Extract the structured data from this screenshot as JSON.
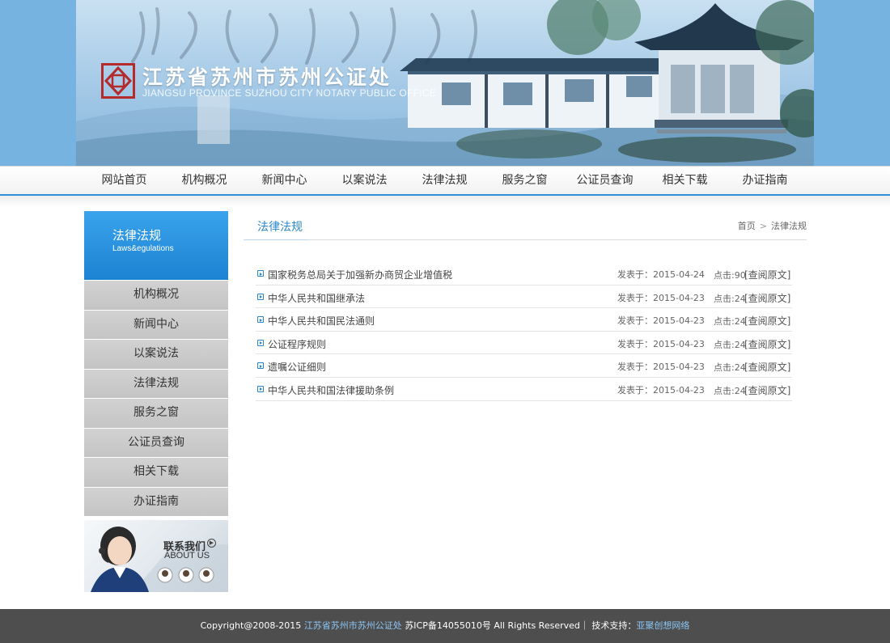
{
  "header": {
    "site_title": "江苏省苏州市苏州公证处",
    "site_subtitle": "JIANGSU PROVINCE SUZHOU CITY NOTARY PUBLIC OFFICE"
  },
  "nav": {
    "items": [
      {
        "label": "网站首页"
      },
      {
        "label": "机构概况"
      },
      {
        "label": "新闻中心"
      },
      {
        "label": "以案说法"
      },
      {
        "label": "法律法规"
      },
      {
        "label": "服务之窗"
      },
      {
        "label": "公证员查询"
      },
      {
        "label": "相关下载"
      },
      {
        "label": "办证指南"
      }
    ]
  },
  "sidebar": {
    "title_cn": "法律法规",
    "title_en": "Laws&egulations",
    "items": [
      {
        "label": "机构概况"
      },
      {
        "label": "新闻中心"
      },
      {
        "label": "以案说法"
      },
      {
        "label": "法律法规"
      },
      {
        "label": "服务之窗"
      },
      {
        "label": "公证员查询"
      },
      {
        "label": "相关下载"
      },
      {
        "label": "办证指南"
      }
    ],
    "contact": {
      "label_cn": "联系我们",
      "label_en": "ABOUT US"
    }
  },
  "main": {
    "title": "法律法规",
    "breadcrumb": {
      "home": "首页",
      "separator": ">",
      "current": "法律法规"
    },
    "articles": [
      {
        "title": "国家税务总局关于加强新办商贸企业增值税",
        "date": "发表于：2015-04-24",
        "hits": "点击:90",
        "view": "[查阅原文]"
      },
      {
        "title": "中华人民共和国继承法",
        "date": "发表于：2015-04-23",
        "hits": "点击:24",
        "view": "[查阅原文]"
      },
      {
        "title": "中华人民共和国民法通则",
        "date": "发表于：2015-04-23",
        "hits": "点击:24",
        "view": "[查阅原文]"
      },
      {
        "title": "公证程序规则",
        "date": "发表于：2015-04-23",
        "hits": "点击:24",
        "view": "[查阅原文]"
      },
      {
        "title": "遗嘱公证细则",
        "date": "发表于：2015-04-23",
        "hits": "点击:24",
        "view": "[查阅原文]"
      },
      {
        "title": "中华人民共和国法律援助条例",
        "date": "发表于：2015-04-23",
        "hits": "点击:24",
        "view": "[查阅原文]"
      }
    ]
  },
  "footer": {
    "copyright": "Copyright@2008-2015",
    "org_link": "江苏省苏州市苏州公证处",
    "icp": "苏ICP备14055010号 All Rights Reserved｜ 技术支持：",
    "tech_link": "亚聚创想网络"
  },
  "colors": {
    "accent": "#2a86c9",
    "nav_border": "#2f8fd8",
    "sidebar_head": "#1c82d2",
    "footer_bg": "#4e4e4e",
    "footer_link": "#8cc6f5"
  }
}
